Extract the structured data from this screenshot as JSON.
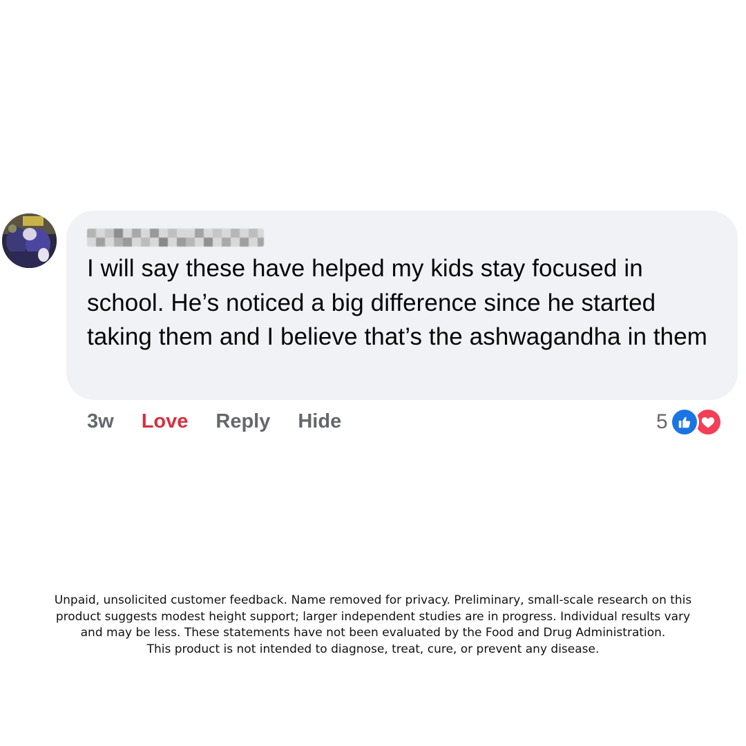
{
  "comment": {
    "author_name": "",
    "text": "I will say these have helped my kids stay focused in school. He’s noticed a big difference since he started taking them and I believe that’s the ashwagandha in them",
    "actions": {
      "time": "3w",
      "love": "Love",
      "reply": "Reply",
      "hide": "Hide"
    },
    "reactions": {
      "count": "5",
      "icons": [
        "like-icon",
        "love-icon"
      ]
    }
  },
  "disclaimer": {
    "lines": [
      "Unpaid, unsolicited customer feedback. Name removed for privacy. Preliminary, small-scale research on this",
      "product suggests modest height support; larger independent studies are in progress. Individual results vary",
      "and may be less. These statements have not been evaluated by the Food and Drug Administration.",
      "This product is not intended to diagnose, treat, cure, or prevent any disease."
    ]
  },
  "colors": {
    "bubble_bg": "#f0f2f5",
    "love_red": "#d6303f",
    "secondary_text": "#65676b",
    "like_blue": "#1b74e4",
    "love_pink": "#f33e58"
  }
}
